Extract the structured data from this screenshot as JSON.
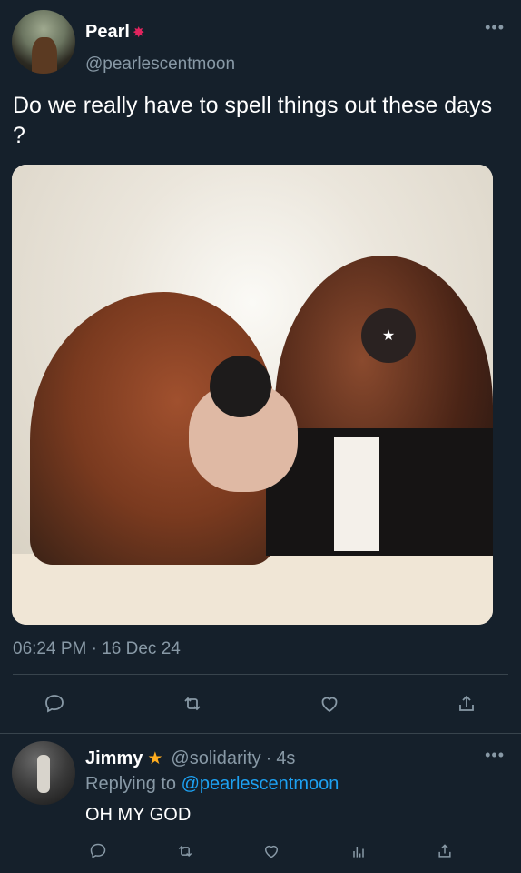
{
  "tweet": {
    "display_name": "Pearl",
    "name_emoji_icon": "collision-icon",
    "handle": "@pearlescentmoon",
    "text": "Do we really have to spell things out these days ?",
    "timestamp": "06:24 PM · 16 Dec 24",
    "more_icon": "more-icon"
  },
  "reply": {
    "display_name": "Jimmy",
    "name_emoji_icon": "star-icon",
    "handle": "@solidarity",
    "separator": "·",
    "time": "4s",
    "replying_prefix": "Replying to",
    "replying_to": "@pearlescentmoon",
    "text": "OH MY GOD"
  },
  "colors": {
    "background": "#15202b",
    "secondary_text": "#8899a6",
    "link": "#1da1f2",
    "divider": "#38444d",
    "star": "#ffad1f"
  }
}
